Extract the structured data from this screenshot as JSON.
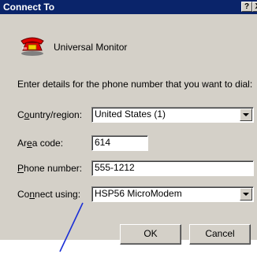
{
  "window": {
    "title": "Connect To",
    "help_btn": "?",
    "close_btn": "X"
  },
  "header": {
    "connection_name": "Universal Monitor",
    "icon": "phone-icon"
  },
  "instructions": "Enter details for the phone number that you want to dial:",
  "fields": {
    "country": {
      "label_pre": "C",
      "label_acc": "o",
      "label_post": "untry/region:",
      "value": "United States (1)"
    },
    "area": {
      "label_pre": "Ar",
      "label_acc": "e",
      "label_post": "a code:",
      "value": "614"
    },
    "phone": {
      "label_pre": "",
      "label_acc": "P",
      "label_post": "hone number:",
      "value": "555-1212"
    },
    "connect": {
      "label_pre": "Co",
      "label_acc": "n",
      "label_post": "nect using:",
      "value": "HSP56 MicroModem"
    }
  },
  "buttons": {
    "ok": "OK",
    "cancel": "Cancel"
  },
  "colors": {
    "titlebar": "#0a246a",
    "face": "#d4d0c8",
    "annotation_line": "#1b2fd6"
  }
}
